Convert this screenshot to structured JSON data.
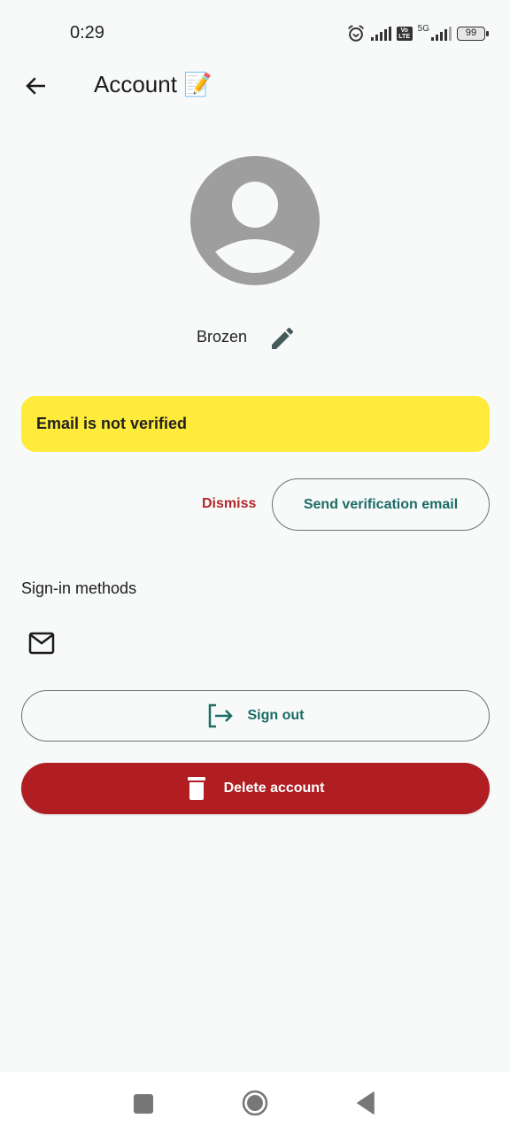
{
  "status_bar": {
    "time": "0:29",
    "network_label": "5G",
    "volte_label": "Vo LTE",
    "battery": "99",
    "icons": [
      "alarm-icon",
      "signal-icon",
      "volte-icon",
      "5g-signal-icon",
      "battery-icon"
    ]
  },
  "app_bar": {
    "title": "Account 📝",
    "back_icon": "arrow-left-icon"
  },
  "profile": {
    "avatar_icon": "account-circle-icon",
    "name": "Brozen",
    "edit_icon": "pencil-icon"
  },
  "verification_banner": {
    "message": "Email is not verified",
    "dismiss_label": "Dismiss",
    "send_label": "Send verification email"
  },
  "sign_in_methods": {
    "title": "Sign-in methods",
    "methods": [
      {
        "icon": "mail-icon"
      }
    ]
  },
  "actions": {
    "sign_out_label": "Sign out",
    "delete_label": "Delete account"
  },
  "colors": {
    "background": "#f8fafa",
    "banner": "#ffeb3b",
    "primary_teal": "#1b6b66",
    "danger_red": "#b01e22",
    "dismiss_red": "#b3262a"
  },
  "nav_bar": {
    "buttons": [
      "recents-button",
      "home-button",
      "back-button"
    ]
  }
}
